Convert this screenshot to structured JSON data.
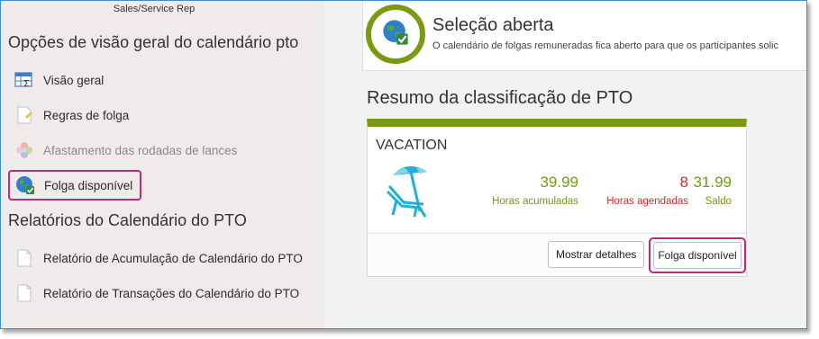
{
  "sidebar": {
    "role_label": "Sales/Service Rep",
    "overview_section_title": "Opções de visão geral do calendário pto",
    "overview_items": [
      {
        "label": "Visão geral",
        "icon": "table-sigma-icon"
      },
      {
        "label": "Regras de folga",
        "icon": "document-icon"
      },
      {
        "label": "Afastamento das rodadas de lances",
        "icon": "pinwheel-icon",
        "disabled": true
      },
      {
        "label": "Folga disponível",
        "icon": "globe-check-icon",
        "highlighted": true
      }
    ],
    "reports_section_title": "Relatórios do Calendário do PTO",
    "report_items": [
      {
        "label": "Relatório de Acumulação de Calendário do PTO",
        "icon": "document-icon"
      },
      {
        "label": "Relatório de Transações do Calendário do PTO",
        "icon": "document-icon"
      }
    ]
  },
  "header": {
    "title": "Seleção aberta",
    "subtitle": "O calendário de folgas remuneradas fica aberto para que os participantes solic",
    "icon": "globe-check-icon"
  },
  "summary": {
    "title": "Resumo da classificação de PTO",
    "card": {
      "type": "VACATION",
      "icon": "beach-umbrella-chair-icon",
      "accrued_value": "39.99",
      "accrued_label": "Horas acumuladas",
      "scheduled_value": "8",
      "scheduled_label": "Horas agendadas",
      "balance_value": "31.99",
      "balance_label": "Saldo",
      "details_button": "Mostrar detalhes",
      "available_button": "Folga disponível"
    }
  },
  "colors": {
    "accent_green": "#7a9a14",
    "highlight_magenta": "#b0307a",
    "scheduled_red": "#c23232",
    "sidebar_bg": "#f0ebeb"
  }
}
